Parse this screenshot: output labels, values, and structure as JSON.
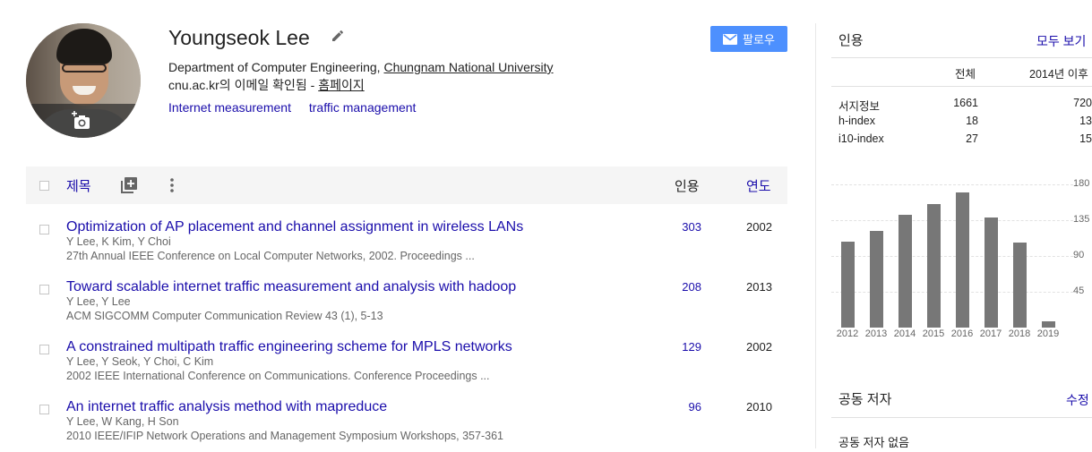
{
  "profile": {
    "name": "Youngseok Lee",
    "affiliation_prefix": "Department of Computer Engineering, ",
    "affiliation_link": "Chungnam National University",
    "email_text": "cnu.ac.kr의 이메일 확인됨 - ",
    "homepage_label": "홈페이지",
    "interests": [
      "Internet measurement",
      "traffic management"
    ],
    "follow_label": "팔로우"
  },
  "table_header": {
    "title_label": "제목",
    "cited_by_label": "인용",
    "year_label": "연도"
  },
  "articles": [
    {
      "title": "Optimization of AP placement and channel assignment in wireless LANs",
      "authors": "Y Lee, K Kim, Y Choi",
      "venue": "27th Annual IEEE Conference on Local Computer Networks, 2002. Proceedings ...",
      "cited_by": "303",
      "year": "2002"
    },
    {
      "title": "Toward scalable internet traffic measurement and analysis with hadoop",
      "authors": "Y Lee, Y Lee",
      "venue": "ACM SIGCOMM Computer Communication Review 43 (1), 5-13",
      "cited_by": "208",
      "year": "2013"
    },
    {
      "title": "A constrained multipath traffic engineering scheme for MPLS networks",
      "authors": "Y Lee, Y Seok, Y Choi, C Kim",
      "venue": "2002 IEEE International Conference on Communications. Conference Proceedings ...",
      "cited_by": "129",
      "year": "2002"
    },
    {
      "title": "An internet traffic analysis method with mapreduce",
      "authors": "Y Lee, W Kang, H Son",
      "venue": "2010 IEEE/IFIP Network Operations and Management Symposium Workshops, 357-361",
      "cited_by": "96",
      "year": "2010"
    }
  ],
  "citations": {
    "title": "인용",
    "view_all_label": "모두 보기",
    "col_all": "전체",
    "col_since": "2014년 이후",
    "rows": [
      {
        "label": "서지정보",
        "all": "1661",
        "since": "720"
      },
      {
        "label": "h-index",
        "all": "18",
        "since": "13"
      },
      {
        "label": "i10-index",
        "all": "27",
        "since": "15"
      }
    ]
  },
  "chart_data": {
    "type": "bar",
    "categories": [
      "2012",
      "2013",
      "2014",
      "2015",
      "2016",
      "2017",
      "2018",
      "2019"
    ],
    "values": [
      108,
      122,
      142,
      155,
      170,
      138,
      107,
      8
    ],
    "ylim": [
      0,
      180
    ],
    "y_ticks": [
      "180",
      "135",
      "90",
      "45"
    ],
    "y_tick_values": [
      180,
      135,
      90,
      45
    ],
    "grid": true,
    "bar_color": "#777777"
  },
  "coauthors": {
    "title": "공동 저자",
    "edit_label": "수정",
    "empty_text": "공동 저자 없음"
  },
  "colors": {
    "link": "#1a0dab",
    "follow_button": "#4d90fe"
  }
}
